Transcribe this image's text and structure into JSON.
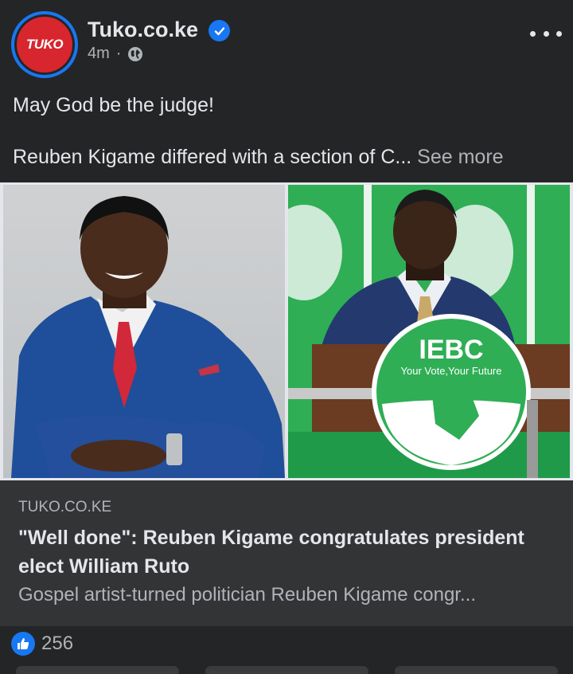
{
  "post": {
    "page_name": "Tuko.co.ke",
    "avatar_text": "TUKO",
    "timestamp": "4m",
    "separator": "·",
    "privacy_icon": "globe-icon",
    "verified_icon": "verified-badge-icon",
    "more_icon": "more-options-icon",
    "caption_line1": "May God be the judge!",
    "caption_line2": "Reuben Kigame differed with a section of C...",
    "see_more": "See more"
  },
  "photos": {
    "right_podium_text": "IEBC",
    "right_podium_slogan": "Your Vote,Your Future"
  },
  "link_preview": {
    "domain": "TUKO.CO.KE",
    "title": "\"Well done\": Reuben Kigame congratulates president elect William Ruto",
    "description": "Gospel artist-turned politician Reuben Kigame congr..."
  },
  "reactions": {
    "icon": "like-icon",
    "count": "256"
  },
  "colors": {
    "background": "#242526",
    "card": "#323436",
    "accent": "#1877f2",
    "brand_red": "#d7262e",
    "iebc_green": "#2fae55"
  }
}
